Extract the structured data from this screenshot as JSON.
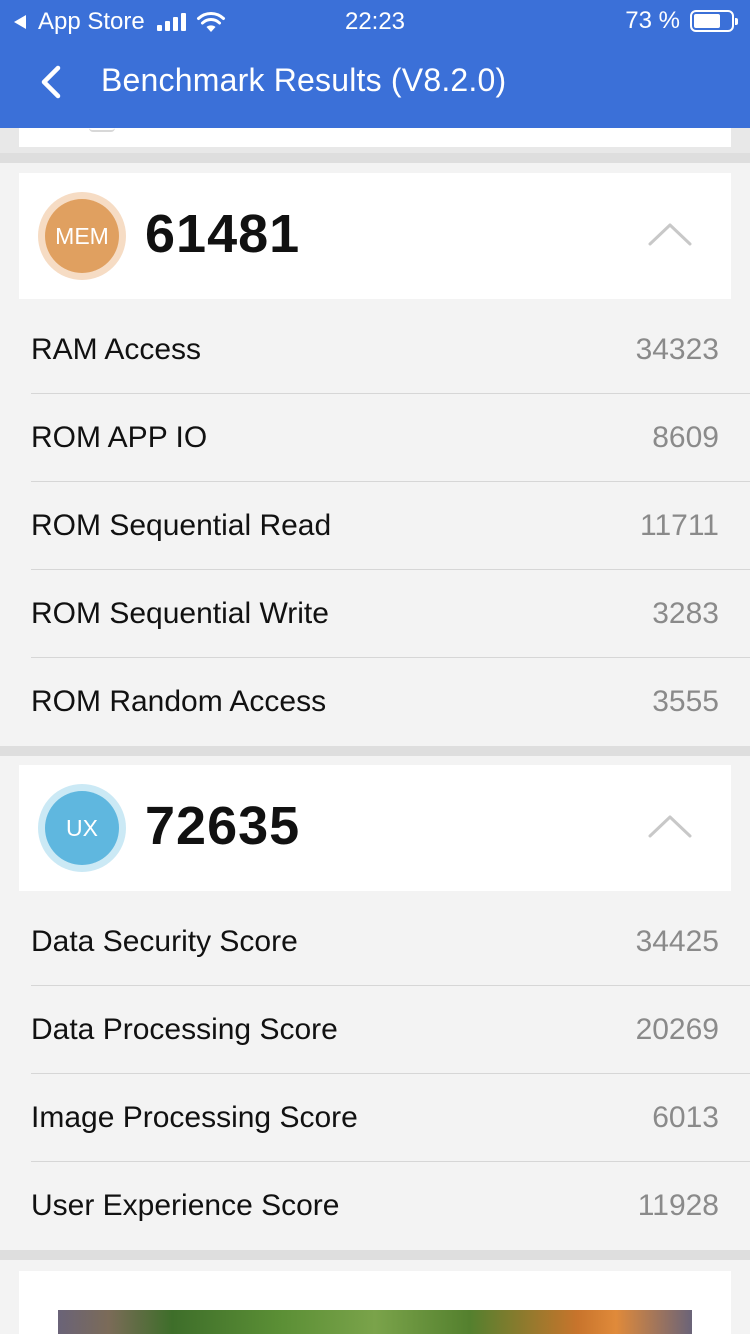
{
  "status_bar": {
    "back_app": "App Store",
    "time": "22:23",
    "battery_text": "73 %",
    "battery_level": 0.73,
    "signal_bars": 4
  },
  "nav": {
    "title": "Benchmark Results (V8.2.0)",
    "back_icon": "chevron-left-icon"
  },
  "colors": {
    "header_bg": "#3b70d8",
    "mem_badge": "#e0a060",
    "ux_badge": "#5fb7df"
  },
  "sections": {
    "mem": {
      "badge": "MEM",
      "score": "61481",
      "collapse_icon": "chevron-up-icon",
      "rows": [
        {
          "label": "RAM Access",
          "value": "34323"
        },
        {
          "label": "ROM APP IO",
          "value": "8609"
        },
        {
          "label": "ROM Sequential Read",
          "value": "11711"
        },
        {
          "label": "ROM Sequential Write",
          "value": "3283"
        },
        {
          "label": "ROM Random Access",
          "value": "3555"
        }
      ]
    },
    "ux": {
      "badge": "UX",
      "score": "72635",
      "collapse_icon": "chevron-up-icon",
      "rows": [
        {
          "label": "Data Security Score",
          "value": "34425"
        },
        {
          "label": "Data Processing Score",
          "value": "20269"
        },
        {
          "label": "Image Processing Score",
          "value": "6013"
        },
        {
          "label": "User Experience Score",
          "value": "11928"
        }
      ]
    }
  }
}
